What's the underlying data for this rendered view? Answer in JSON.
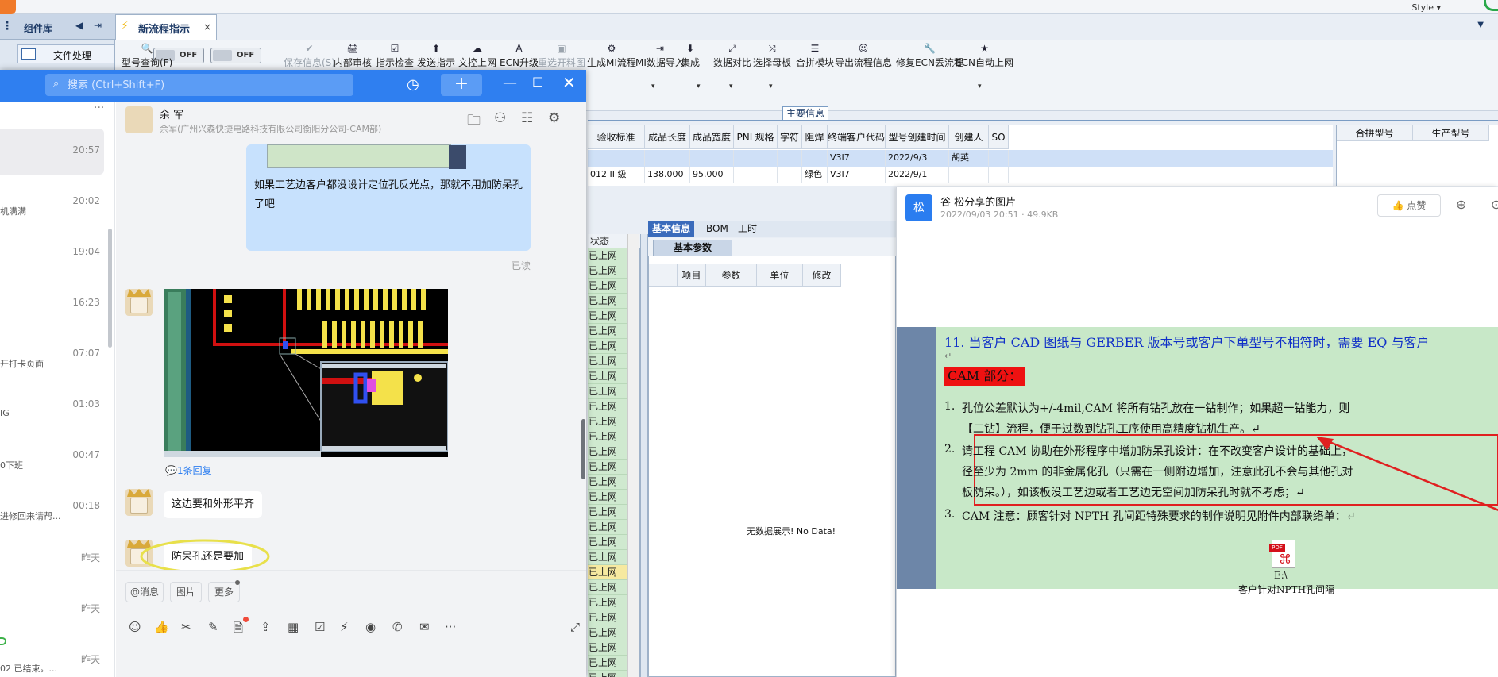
{
  "erp": {
    "style_label": "Style ▾",
    "component_library": {
      "title": "组件库",
      "arrow": "◀",
      "pin": "⇥",
      "item_label": "文件处理"
    },
    "flow_tab": {
      "label": "新流程指示",
      "close": "×"
    },
    "toggles": [
      "OFF",
      "OFF"
    ],
    "toolbar": [
      {
        "icon": "🔍",
        "label": "型号查询(F)",
        "disabled": false
      },
      {
        "icon": "✔",
        "label": "保存信息(S)",
        "disabled": true
      },
      {
        "icon": "🖨",
        "label": "内部审核",
        "disabled": false
      },
      {
        "icon": "☑",
        "label": "指示检查",
        "disabled": false
      },
      {
        "icon": "⬆",
        "label": "发送指示",
        "disabled": false
      },
      {
        "icon": "☁",
        "label": "文控上网",
        "disabled": false
      },
      {
        "icon": "A",
        "label": "ECN升级",
        "disabled": false
      },
      {
        "icon": "▣",
        "label": "重选开料图",
        "disabled": true
      },
      {
        "icon": "⚙",
        "label": "生成MI流程",
        "disabled": false
      },
      {
        "icon": "⇥",
        "label": "MI数据导入",
        "disabled": false
      },
      {
        "icon": "⬇",
        "label": "集成",
        "disabled": false
      },
      {
        "icon": "⤢",
        "label": "数据对比",
        "disabled": false
      },
      {
        "icon": "⤨",
        "label": "选择母板",
        "disabled": false
      },
      {
        "icon": "☰",
        "label": "合拼模块",
        "disabled": false
      },
      {
        "icon": "☺",
        "label": "导出流程信息",
        "disabled": false
      },
      {
        "icon": "🔧",
        "label": "修复ECN丢流程",
        "disabled": false
      },
      {
        "icon": "★",
        "label": "ECN自动上网",
        "disabled": false
      }
    ],
    "main_info_tab": "主要信息",
    "grid": {
      "headers": [
        "验收标准",
        "成品长度",
        "成品宽度",
        "PNL规格",
        "字符",
        "阻焊",
        "终端客户代码",
        "型号创建时间",
        "创建人",
        "SO"
      ],
      "rows": [
        [
          "",
          "",
          "",
          "",
          "",
          "",
          "V3I7",
          "2022/9/3",
          "胡英",
          ""
        ],
        [
          "012 II 级",
          "138.000",
          "95.000",
          "",
          "",
          "绿色",
          "V3I7",
          "2022/9/1",
          "",
          ""
        ]
      ]
    },
    "right_grid_headers": [
      "合拼型号",
      "生产型号"
    ],
    "status": {
      "header": "状态",
      "rows": [
        "已上网",
        "已上网",
        "已上网",
        "已上网",
        "已上网",
        "已上网",
        "已上网",
        "已上网",
        "已上网",
        "已上网",
        "已上网",
        "已上网",
        "已上网",
        "已上网",
        "已上网",
        "已上网",
        "已上网",
        "已上网",
        "已上网",
        "已上网",
        "已上网",
        "已上网",
        "已上网",
        "已上网",
        "已上网",
        "已上网",
        "已上网",
        "已上网",
        "已上网"
      ]
    },
    "basic_tabs": [
      "基本信息",
      "BOM",
      "工时"
    ],
    "basic_sub_tab": "基本参数",
    "param_headers": [
      "项目",
      "参数",
      "单位",
      "修改"
    ],
    "no_data": "无数据展示! No Data!"
  },
  "chat": {
    "search_placeholder": "搜索 (Ctrl+Shift+F)",
    "conversations": [
      {
        "time": "20:57",
        "preview": ""
      },
      {
        "time": "20:02",
        "preview": "机满满"
      },
      {
        "time": "19:04",
        "preview": ""
      },
      {
        "time": "16:23",
        "preview": ""
      },
      {
        "time": "07:07",
        "preview": "开打卡页面"
      },
      {
        "time": "01:03",
        "preview": "IG"
      },
      {
        "time": "00:47",
        "preview": "0下班"
      },
      {
        "time": "00:18",
        "preview": "进修回来请帮..."
      },
      {
        "time": "昨天",
        "preview": ""
      },
      {
        "time": "昨天",
        "preview": ""
      },
      {
        "time": "昨天",
        "preview": "02 已结束。..."
      }
    ],
    "contact": {
      "name": "余 军",
      "subtitle": "余军(广州兴森快捷电路科技有限公司衡阳分公司-CAM部)"
    },
    "messages": {
      "out_text": "如果工艺边客户都没设计定位孔反光点，那就不用加防呆孔了吧",
      "read": "已读",
      "reply_link": "1条回复",
      "msg2": "这边要和外形平齐",
      "msg3": "防呆孔还是要加"
    },
    "chips": [
      "@消息",
      "图片",
      "更多"
    ]
  },
  "viewer": {
    "avatar_char": "松",
    "title": "谷 松分享的图片",
    "meta": "2022/09/03 20:51 · 49.9KB",
    "like": "点赞",
    "doc": {
      "line11": "11.  当客户 CAD 图纸与 GERBER 版本号或客户下单型号不相符时，需要 EQ 与客户",
      "cam_header": "CAM 部分：",
      "l1a": "孔位公差默认为+/-4mil,CAM 将所有钻孔放在一钻制作；如果超一钻能力，则",
      "l1b": "【二钻】流程，便于过数到钻孔工序使用高精度钻机生产。↵",
      "l2a": "请工程 CAM 协助在外形程序中增加防呆孔设计：在不改变客户设计的基础上，",
      "l2b": "径至少为 2mm 的非金属化孔（只需在一侧附边增加，注意此孔不会与其他孔对",
      "l2c": "板防呆。），如该板没工艺边或者工艺边无空间加防呆孔时就不考虑；↵",
      "l3": "CAM 注意：顾客针对 NPTH 孔间距特殊要求的制作说明见附件内部联络单：↵",
      "n1": "1.",
      "n2": "2.",
      "n3": "3.",
      "pdf_badge": "PDF",
      "pdf_path": "E:\\",
      "pdf_name": "客户针对NPTH孔间隔"
    }
  }
}
